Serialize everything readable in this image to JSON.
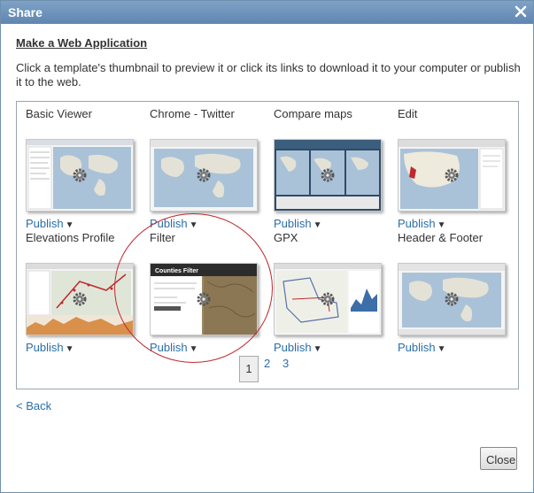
{
  "dialog": {
    "title": "Share",
    "heading": "Make a Web Application",
    "description": "Click a template's thumbnail to preview it or click its links to download it to your computer or publish it to the web.",
    "back_label": "< Back",
    "close_label": "Close"
  },
  "templates": [
    {
      "name": "Basic Viewer",
      "publish": "Publish"
    },
    {
      "name": "Chrome - Twitter",
      "publish": "Publish"
    },
    {
      "name": "Compare maps",
      "publish": "Publish"
    },
    {
      "name": "Edit",
      "publish": "Publish"
    },
    {
      "name": "Elevations Profile",
      "publish": "Publish"
    },
    {
      "name": "Filter",
      "publish": "Publish",
      "thumb_title": "Counties Filter"
    },
    {
      "name": "GPX",
      "publish": "Publish"
    },
    {
      "name": "Header & Footer",
      "publish": "Publish"
    }
  ],
  "pagination": {
    "pages": [
      "1",
      "2",
      "3"
    ],
    "current": "1"
  },
  "colors": {
    "title_bar": "#6c90b8",
    "link": "#2a6ea8",
    "annotation": "#c0282d"
  }
}
